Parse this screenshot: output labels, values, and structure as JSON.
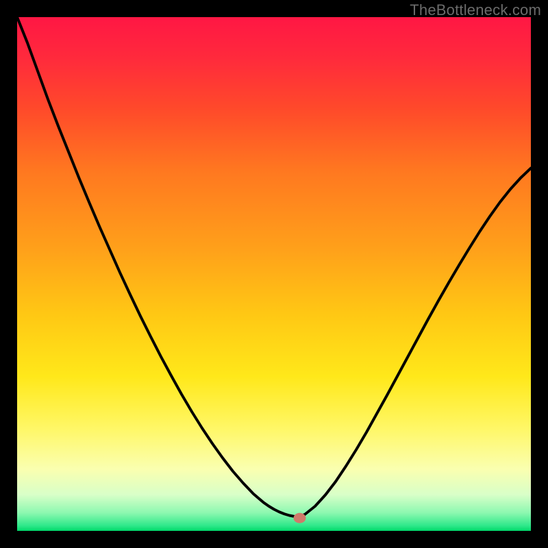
{
  "watermark": "TheBottleneck.com",
  "chart_data": {
    "type": "line",
    "title": "",
    "xlabel": "",
    "ylabel": "",
    "xlim": [
      0,
      100
    ],
    "ylim": [
      0,
      100
    ],
    "x": [
      0,
      2,
      4,
      6,
      8,
      10,
      12,
      14,
      16,
      18,
      20,
      22,
      24,
      26,
      28,
      30,
      32,
      34,
      36,
      38,
      40,
      42,
      44,
      46,
      48,
      49,
      50,
      51,
      52,
      53,
      54,
      55,
      56,
      58,
      60,
      62,
      64,
      66,
      68,
      70,
      72,
      74,
      76,
      78,
      80,
      82,
      84,
      86,
      88,
      90,
      92,
      94,
      96,
      98,
      100
    ],
    "y": [
      100,
      95,
      89.5,
      84,
      78.8,
      73.8,
      68.8,
      64,
      59.3,
      54.8,
      50.3,
      46,
      41.8,
      37.8,
      33.9,
      30.2,
      26.6,
      23.2,
      20,
      17,
      14.2,
      11.6,
      9.3,
      7.2,
      5.5,
      4.8,
      4.2,
      3.7,
      3.3,
      3,
      2.8,
      2.85,
      3.2,
      4.8,
      7,
      9.6,
      12.6,
      15.8,
      19.2,
      22.8,
      26.4,
      30.1,
      33.8,
      37.5,
      41.2,
      44.8,
      48.3,
      51.7,
      55,
      58.2,
      61.2,
      64,
      66.5,
      68.7,
      70.6
    ],
    "marker_point": {
      "x": 55,
      "y": 2.5
    },
    "gradient_stops": [
      {
        "offset": 0.0,
        "color": "#ff1744"
      },
      {
        "offset": 0.08,
        "color": "#ff2a3c"
      },
      {
        "offset": 0.18,
        "color": "#ff4a2a"
      },
      {
        "offset": 0.3,
        "color": "#ff7820"
      },
      {
        "offset": 0.45,
        "color": "#ffa01a"
      },
      {
        "offset": 0.58,
        "color": "#ffc814"
      },
      {
        "offset": 0.7,
        "color": "#ffe81a"
      },
      {
        "offset": 0.8,
        "color": "#fff766"
      },
      {
        "offset": 0.88,
        "color": "#faffb0"
      },
      {
        "offset": 0.93,
        "color": "#d8ffc8"
      },
      {
        "offset": 0.965,
        "color": "#8cf8b0"
      },
      {
        "offset": 0.99,
        "color": "#2ee88a"
      },
      {
        "offset": 1.0,
        "color": "#00d86a"
      }
    ]
  }
}
